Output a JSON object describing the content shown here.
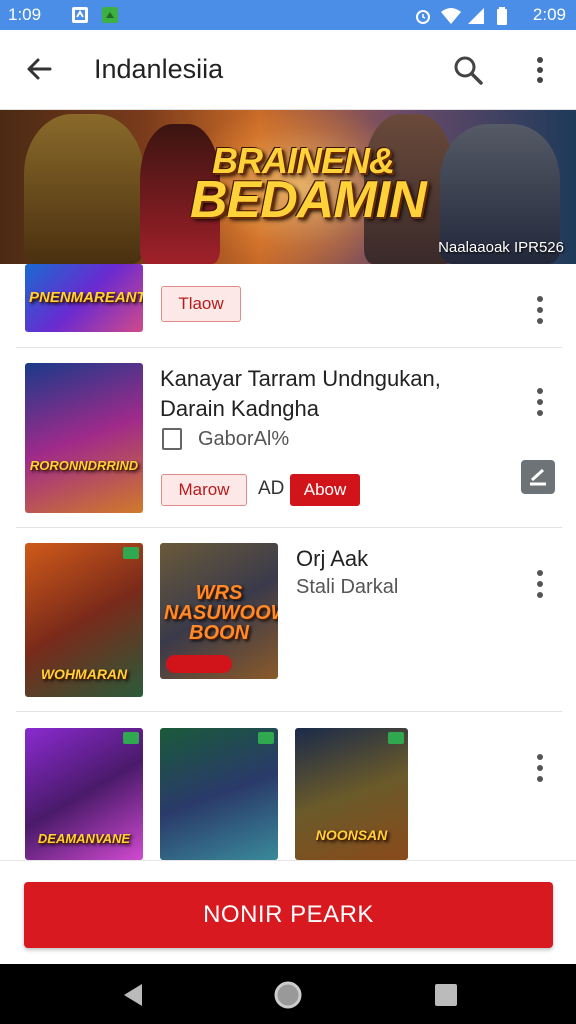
{
  "status_bar": {
    "time": "1:09",
    "right_time": "2:09",
    "colors": {
      "bg": "#4a8ee8"
    },
    "icons": [
      "app-notification-icon",
      "app-notification-icon",
      "alarm-icon",
      "wifi-icon",
      "signal-icon",
      "battery-icon"
    ]
  },
  "app_bar": {
    "title": "Indanlesiia",
    "icons": {
      "back": "arrow-back-icon",
      "search": "search-icon",
      "more": "more-vert-icon"
    }
  },
  "banner": {
    "title_line1": "BRAINEN&",
    "title_line2": "BEDAMIN",
    "subtitle": "Naalaaoak IPR526"
  },
  "list": {
    "items": [
      {
        "thumb_label": "PNENMAREANT",
        "button_label": "Tlaow"
      },
      {
        "thumb_label": "RORONNDRRIND",
        "title_line1": "Kanayar Tarram Undngukan,",
        "title_line2": "Darain Kadngha",
        "checkbox_label": "GaborAl%",
        "button_outline_label": "Marow",
        "middle_label": "AD",
        "button_solid_label": "Abow"
      },
      {
        "thumbs": [
          "WOHMARAN",
          "WRS NASUWOOW BOON"
        ],
        "title": "Orj Aak",
        "subtitle": "Stali Darkal"
      },
      {
        "thumbs": [
          "DEAMANVANE",
          "",
          "NOONSAN"
        ]
      }
    ]
  },
  "cta": {
    "label": "NONIR PEARK",
    "color": "#d8191f"
  },
  "nav_bar": {
    "icons": [
      "back-triangle-icon",
      "home-circle-icon",
      "recents-square-icon"
    ]
  }
}
